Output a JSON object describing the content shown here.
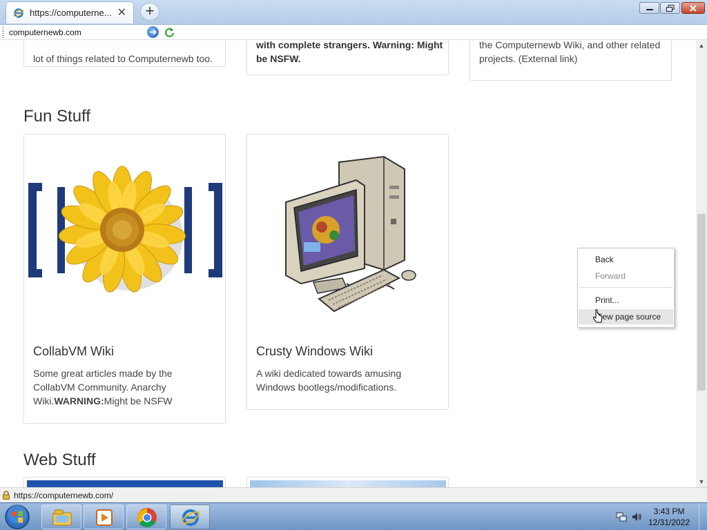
{
  "browser": {
    "tab_title": "https://computerne...",
    "tab_close": "✕",
    "new_tab": "+",
    "address": "computernewb.com",
    "status_url": "https://computernewb.com/"
  },
  "page": {
    "top_cards": [
      {
        "text_plain": "lot of things related to Computernewb too."
      },
      {
        "text_top_partial": "with complete strangers. Warning: Might",
        "text_bold": "be NSFW."
      },
      {
        "text": "the Computernewb Wiki, and other related projects. (External link)"
      }
    ],
    "fun_stuff": {
      "heading": "Fun Stuff",
      "cards": [
        {
          "title": "CollabVM Wiki",
          "desc_a": "Some great articles made by the CollabVM Community. Anarchy Wiki.",
          "desc_bold": "WARNING:",
          "desc_b": "Might be NSFW",
          "image_icon": "sunflower-logo-icon"
        },
        {
          "title": "Crusty Windows Wiki",
          "desc": "A wiki dedicated towards amusing Windows bootlegs/modifications.",
          "image_icon": "retro-computer-icon"
        }
      ]
    },
    "web_stuff": {
      "heading": "Web Stuff"
    }
  },
  "context_menu": {
    "items": [
      {
        "label": "Back",
        "enabled": true
      },
      {
        "label": "Forward",
        "enabled": false
      },
      {
        "label": "Print...",
        "enabled": true
      },
      {
        "label": "View page source",
        "enabled": true,
        "hover": true
      }
    ]
  },
  "taskbar": {
    "time": "3:43 PM",
    "date": "12/31/2022",
    "apps": [
      "explorer-icon",
      "media-player-icon",
      "chrome-icon",
      "internet-explorer-icon"
    ]
  },
  "colors": {
    "titlebar": "#c9dcf1",
    "taskbar": "#6f95c4",
    "sunflower": "#f2c21b",
    "bracket_navy": "#1f3a7a"
  }
}
